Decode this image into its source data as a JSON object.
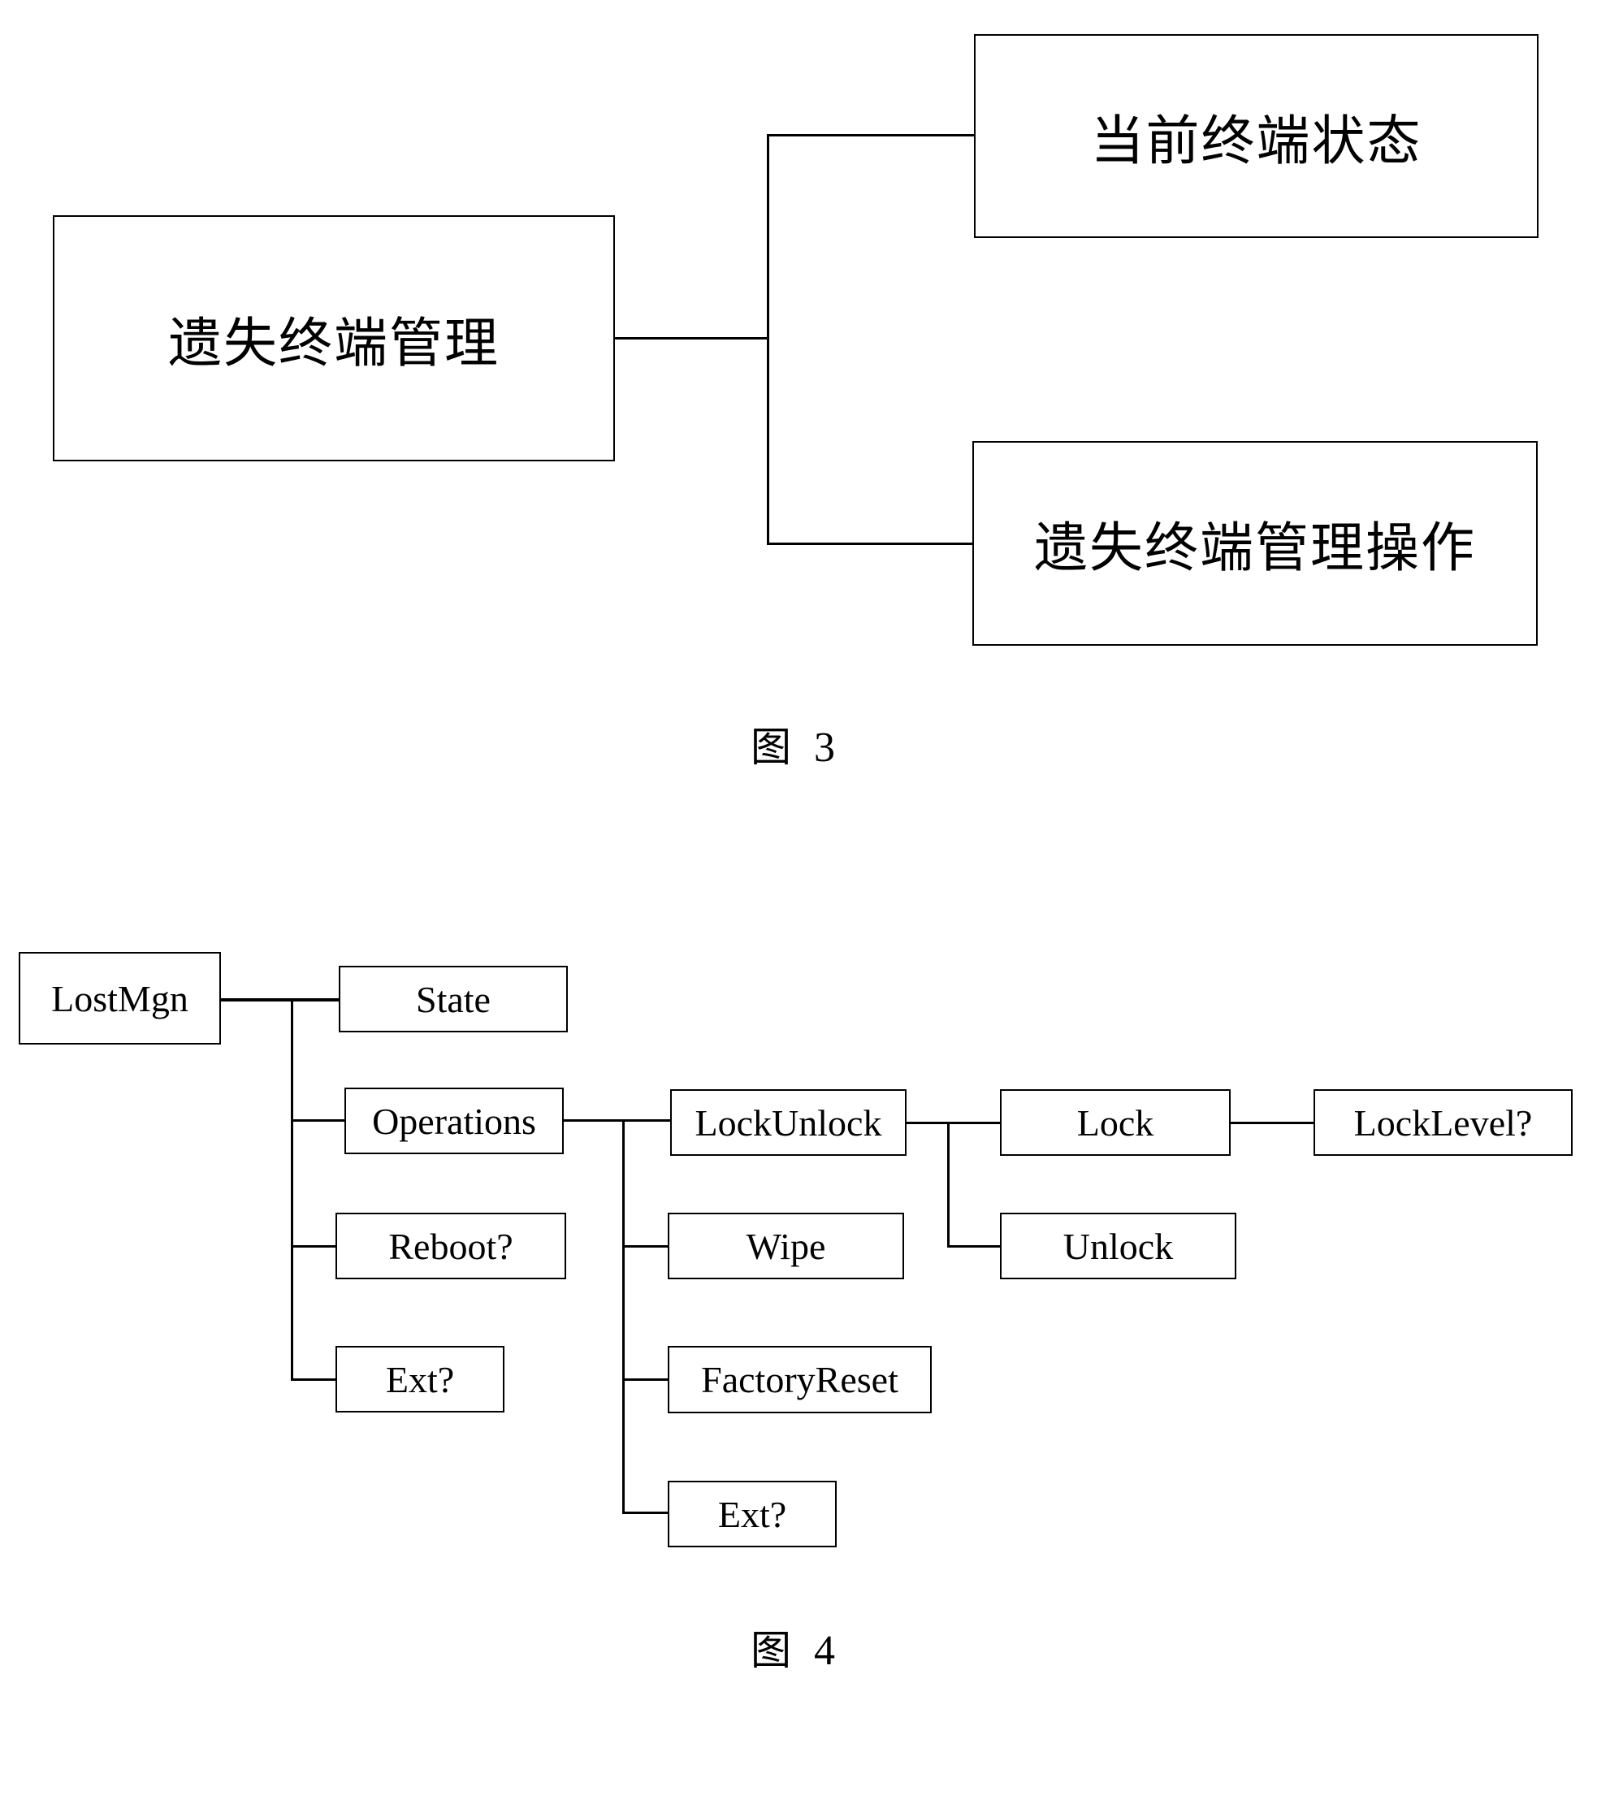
{
  "figure3": {
    "caption_prefix": "图",
    "caption_number": "3",
    "root": "遗失终端管理",
    "children": [
      "当前终端状态",
      "遗失终端管理操作"
    ]
  },
  "figure4": {
    "caption_prefix": "图",
    "caption_number": "4",
    "root": "LostMgn",
    "level1": [
      "State",
      "Operations",
      "Reboot?",
      "Ext?"
    ],
    "operations_children": [
      "LockUnlock",
      "Wipe",
      "FactoryReset",
      "Ext?"
    ],
    "lockunlock_children": [
      "Lock",
      "Unlock"
    ],
    "lock_children": [
      "LockLevel?"
    ]
  }
}
